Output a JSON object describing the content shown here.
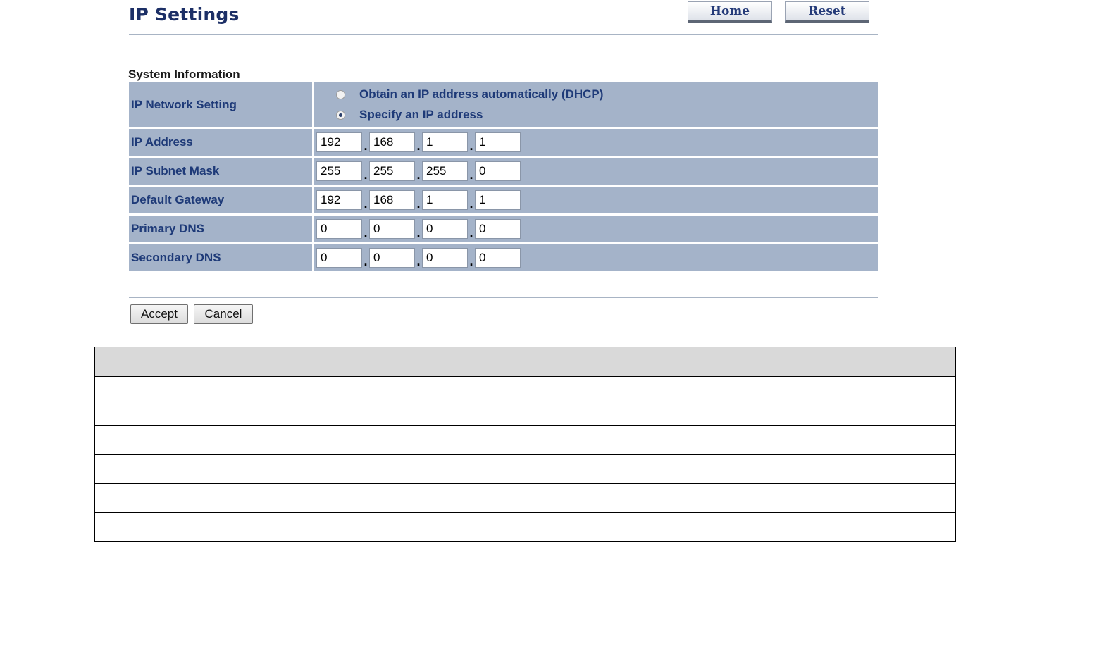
{
  "header": {
    "title": "IP Settings",
    "home_label": "Home",
    "reset_label": "Reset"
  },
  "section_title": "System Information",
  "ip_network_setting": {
    "label": "IP Network Setting",
    "options": [
      {
        "label": "Obtain an IP address automatically (DHCP)",
        "checked": false
      },
      {
        "label": "Specify an IP address",
        "checked": true
      }
    ]
  },
  "address_rows": [
    {
      "label": "IP Address",
      "octets": [
        "192",
        "168",
        "1",
        "1"
      ]
    },
    {
      "label": "IP Subnet Mask",
      "octets": [
        "255",
        "255",
        "255",
        "0"
      ]
    },
    {
      "label": "Default Gateway",
      "octets": [
        "192",
        "168",
        "1",
        "1"
      ]
    },
    {
      "label": "Primary DNS",
      "octets": [
        "0",
        "0",
        "0",
        "0"
      ]
    },
    {
      "label": "Secondary DNS",
      "octets": [
        "0",
        "0",
        "0",
        "0"
      ]
    }
  ],
  "buttons": {
    "accept_label": "Accept",
    "cancel_label": "Cancel"
  },
  "colors": {
    "row_background": "#a4b3c9",
    "label_text": "#1e3a78",
    "title_text": "#1c2f66",
    "table_header_background": "#d9d9d9"
  }
}
